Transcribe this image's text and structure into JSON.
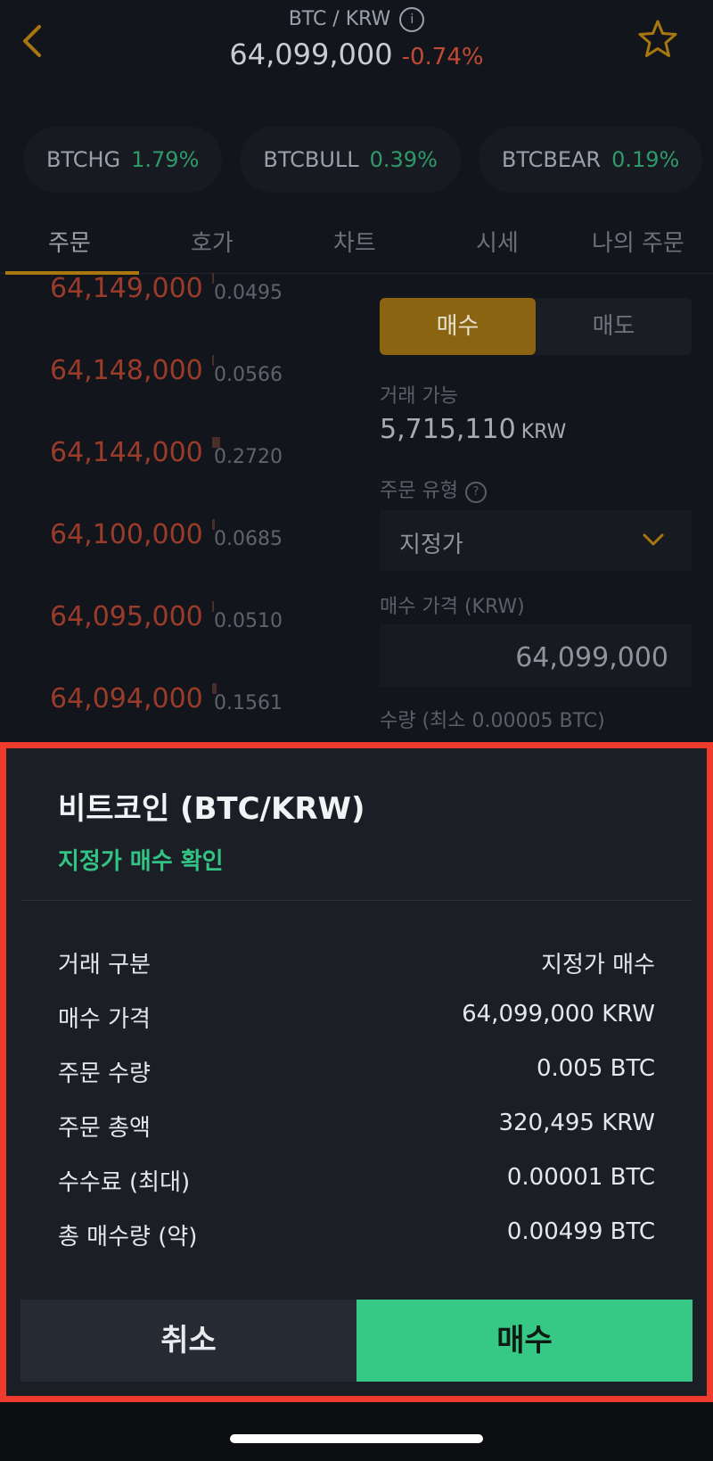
{
  "header": {
    "pair": "BTC / KRW",
    "price": "64,099,000",
    "change": "-0.74%"
  },
  "chips": [
    {
      "name": "BTCHG",
      "pct": "1.79%"
    },
    {
      "name": "BTCBULL",
      "pct": "0.39%"
    },
    {
      "name": "BTCBEAR",
      "pct": "0.19%"
    }
  ],
  "tabs": [
    "주문",
    "호가",
    "차트",
    "시세",
    "나의 주문"
  ],
  "orderbook": [
    {
      "price": "64,149,000",
      "qty": "0.0495"
    },
    {
      "price": "64,148,000",
      "qty": "0.0566"
    },
    {
      "price": "64,144,000",
      "qty": "0.2720"
    },
    {
      "price": "64,100,000",
      "qty": "0.0685"
    },
    {
      "price": "64,095,000",
      "qty": "0.0510"
    },
    {
      "price": "64,094,000",
      "qty": "0.1561"
    }
  ],
  "panel": {
    "buy_tab": "매수",
    "sell_tab": "매도",
    "available_label": "거래 가능",
    "available_value": "5,715,110",
    "available_unit": "KRW",
    "order_type_label": "주문 유형",
    "order_type_value": "지정가",
    "price_label": "매수 가격 (KRW)",
    "price_value": "64,099,000",
    "qty_label": "수량 (최소 0.00005 BTC)"
  },
  "modal": {
    "title": "비트코인 (BTC/KRW)",
    "subtitle": "지정가 매수 확인",
    "rows": [
      {
        "k": "거래 구분",
        "v": "지정가 매수"
      },
      {
        "k": "매수 가격",
        "v": "64,099,000 KRW"
      },
      {
        "k": "주문 수량",
        "v": "0.005 BTC"
      },
      {
        "k": "주문 총액",
        "v": "320,495 KRW"
      },
      {
        "k": "수수료 (최대)",
        "v": "0.00001 BTC"
      },
      {
        "k": "총 매수량 (약)",
        "v": "0.00499 BTC"
      }
    ],
    "cancel_label": "취소",
    "confirm_label": "매수"
  }
}
